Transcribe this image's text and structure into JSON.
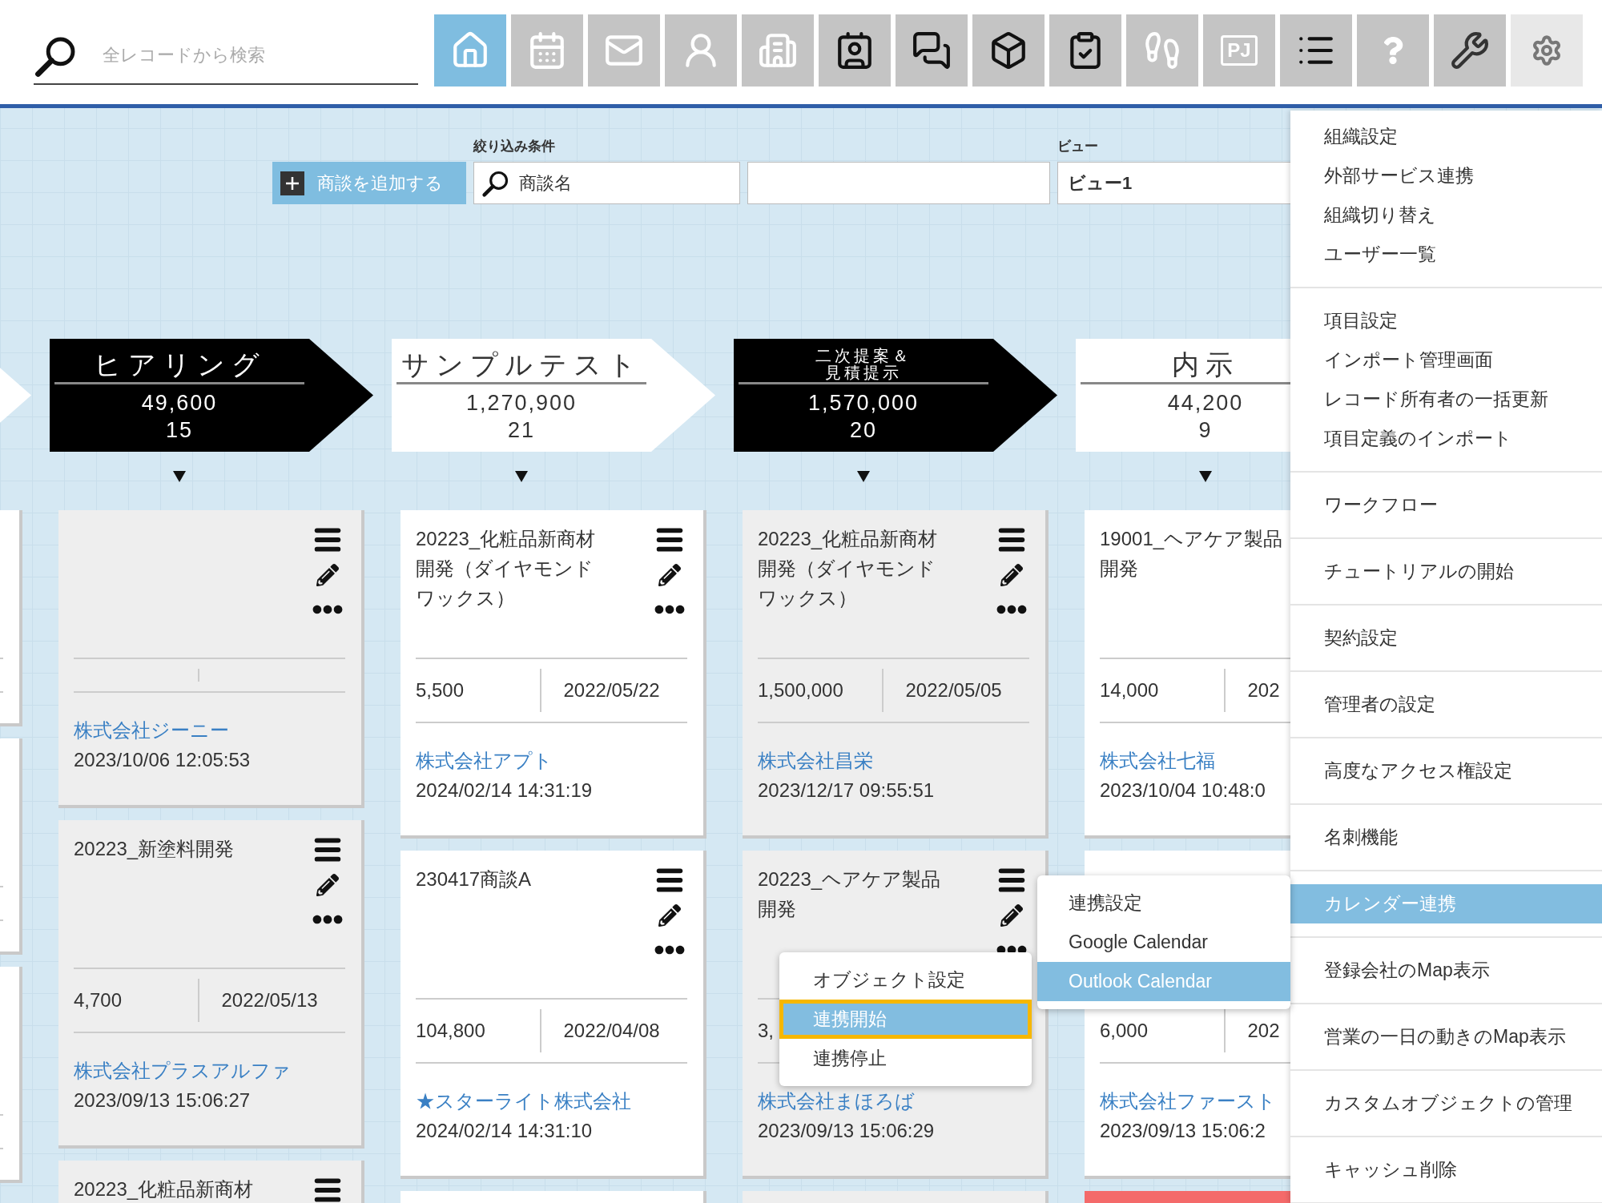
{
  "search": {
    "placeholder": "全レコードから検索"
  },
  "toolbar": [
    {
      "kind": "home",
      "selected": true,
      "open": false
    },
    {
      "kind": "calendar",
      "selected": false,
      "open": false
    },
    {
      "kind": "mail",
      "selected": false,
      "open": false
    },
    {
      "kind": "person",
      "selected": false,
      "open": false
    },
    {
      "kind": "building",
      "selected": false,
      "open": false
    },
    {
      "kind": "card",
      "selected": false,
      "open": false
    },
    {
      "kind": "meeting",
      "selected": false,
      "open": false
    },
    {
      "kind": "box",
      "selected": false,
      "open": false
    },
    {
      "kind": "clipboard",
      "selected": false,
      "open": false
    },
    {
      "kind": "footprints",
      "selected": false,
      "open": false
    },
    {
      "kind": "text",
      "label": "PJ",
      "selected": false,
      "open": false
    },
    {
      "kind": "list",
      "selected": false,
      "open": false
    },
    {
      "kind": "help",
      "selected": false,
      "open": false
    },
    {
      "kind": "wrench",
      "selected": false,
      "open": false
    },
    {
      "kind": "gear",
      "selected": false,
      "open": true
    }
  ],
  "filter": {
    "add_button": "商談を追加する",
    "condition_label": "絞り込み条件",
    "search_field": {
      "value": "商談名"
    },
    "view_label": "ビュー",
    "view_field": {
      "value": "ビュー1"
    }
  },
  "stages": [
    {
      "dark": false,
      "cards": [
        {
          "color": "#ffffff"
        },
        {
          "color": "#ffffff"
        },
        {
          "color": "#ffffff"
        }
      ]
    },
    {
      "title": "ヒアリング",
      "amount": "49,600",
      "count": "15",
      "dark": true,
      "cards": [
        {
          "color": "#eeeeee",
          "company": "株式会社ジーニー",
          "updated": "2023/10/06 12:05:53"
        },
        {
          "color": "#eeeeee",
          "title": "20223_新塗料開発",
          "amount": "4,700",
          "date": "2022/05/13",
          "company": "株式会社プラスアルファ",
          "updated": "2023/09/13 15:06:27"
        },
        {
          "color": "#eeeeee",
          "title": "20223_化粧品新商材"
        }
      ]
    },
    {
      "title": "サンプルテスト",
      "amount": "1,270,900",
      "count": "21",
      "dark": false,
      "cards": [
        {
          "color": "#ffffff",
          "title": "20223_化粧品新商材開発（ダイヤモンドワックス）",
          "amount": "5,500",
          "date": "2022/05/22",
          "company": "株式会社アプト",
          "updated": "2024/02/14 14:31:19"
        },
        {
          "color": "#ffffff",
          "title": "230417商談A",
          "amount": "104,800",
          "date": "2022/04/08",
          "company": "★スターライト株式会社",
          "updated": "2024/02/14 14:31:10"
        },
        {
          "color": "#ffffff"
        }
      ]
    },
    {
      "title": "二次提案＆見積提示",
      "amount": "1,570,000",
      "count": "20",
      "dark": true,
      "cards": [
        {
          "color": "#eeeeee",
          "title": "20223_化粧品新商材開発（ダイヤモンドワックス）",
          "amount": "1,500,000",
          "date": "2022/05/05",
          "company": "株式会社昌栄",
          "updated": "2023/12/17 09:55:51"
        },
        {
          "color": "#eeeeee",
          "title": "20223_ヘアケア製品開発",
          "amount": "3,",
          "company": "株式会社まほろば",
          "updated": "2023/09/13 15:06:29"
        },
        {
          "color": "#eeeeee"
        }
      ]
    },
    {
      "title": "内示",
      "amount": "44,200",
      "count": "9",
      "dark": false,
      "cards": [
        {
          "color": "#ffffff",
          "title": "19001_ヘアケア製品開発",
          "amount": "14,000",
          "date": "202",
          "company": "株式会社七福",
          "updated": "2023/10/04 10:48:0"
        },
        {
          "color": "#ffffff",
          "amount": "6,000",
          "date": "202",
          "company": "株式会社ファースト",
          "updated": "2023/09/13 15:06:2"
        },
        {
          "color": "#f46a6a"
        }
      ]
    }
  ],
  "settings_menu": {
    "groups": [
      {
        "items": [
          {
            "label": "組織設定",
            "selected": false
          },
          {
            "label": "外部サービス連携",
            "selected": false
          },
          {
            "label": "組織切り替え",
            "selected": false
          },
          {
            "label": "ユーザー一覧",
            "selected": false
          }
        ]
      },
      {
        "items": [
          {
            "label": "項目設定",
            "selected": false
          },
          {
            "label": "インポート管理画面",
            "selected": false
          },
          {
            "label": "レコード所有者の一括更新",
            "selected": false
          },
          {
            "label": "項目定義のインポート",
            "selected": false
          }
        ]
      },
      {
        "items": [
          {
            "label": "ワークフロー",
            "selected": false
          }
        ]
      },
      {
        "items": [
          {
            "label": "チュートリアルの開始",
            "selected": false
          }
        ]
      },
      {
        "items": [
          {
            "label": "契約設定",
            "selected": false
          }
        ]
      },
      {
        "items": [
          {
            "label": "管理者の設定",
            "selected": false
          }
        ]
      },
      {
        "items": [
          {
            "label": "高度なアクセス権設定",
            "selected": false
          }
        ]
      },
      {
        "items": [
          {
            "label": "名刺機能",
            "selected": false
          }
        ]
      },
      {
        "items": [
          {
            "label": "カレンダー連携",
            "selected": true,
            "children": [
              {
                "label": "連携設定",
                "selected": false
              },
              {
                "label": "Google Calendar",
                "selected": false
              },
              {
                "label": "Outlook Calendar",
                "selected": true,
                "children": [
                  {
                    "label": "オブジェクト設定",
                    "selected": false,
                    "outlined": false
                  },
                  {
                    "label": "連携開始",
                    "selected": true,
                    "outlined": true
                  },
                  {
                    "label": "連携停止",
                    "selected": false,
                    "outlined": false
                  }
                ]
              }
            ]
          }
        ]
      },
      {
        "items": [
          {
            "label": "登録会社のMap表示",
            "selected": false
          }
        ]
      },
      {
        "items": [
          {
            "label": "営業の一日の動きのMap表示",
            "selected": false
          }
        ]
      },
      {
        "items": [
          {
            "label": "カスタムオブジェクトの管理",
            "selected": false
          }
        ]
      },
      {
        "items": [
          {
            "label": "キャッシュ削除",
            "selected": false
          }
        ]
      }
    ]
  }
}
